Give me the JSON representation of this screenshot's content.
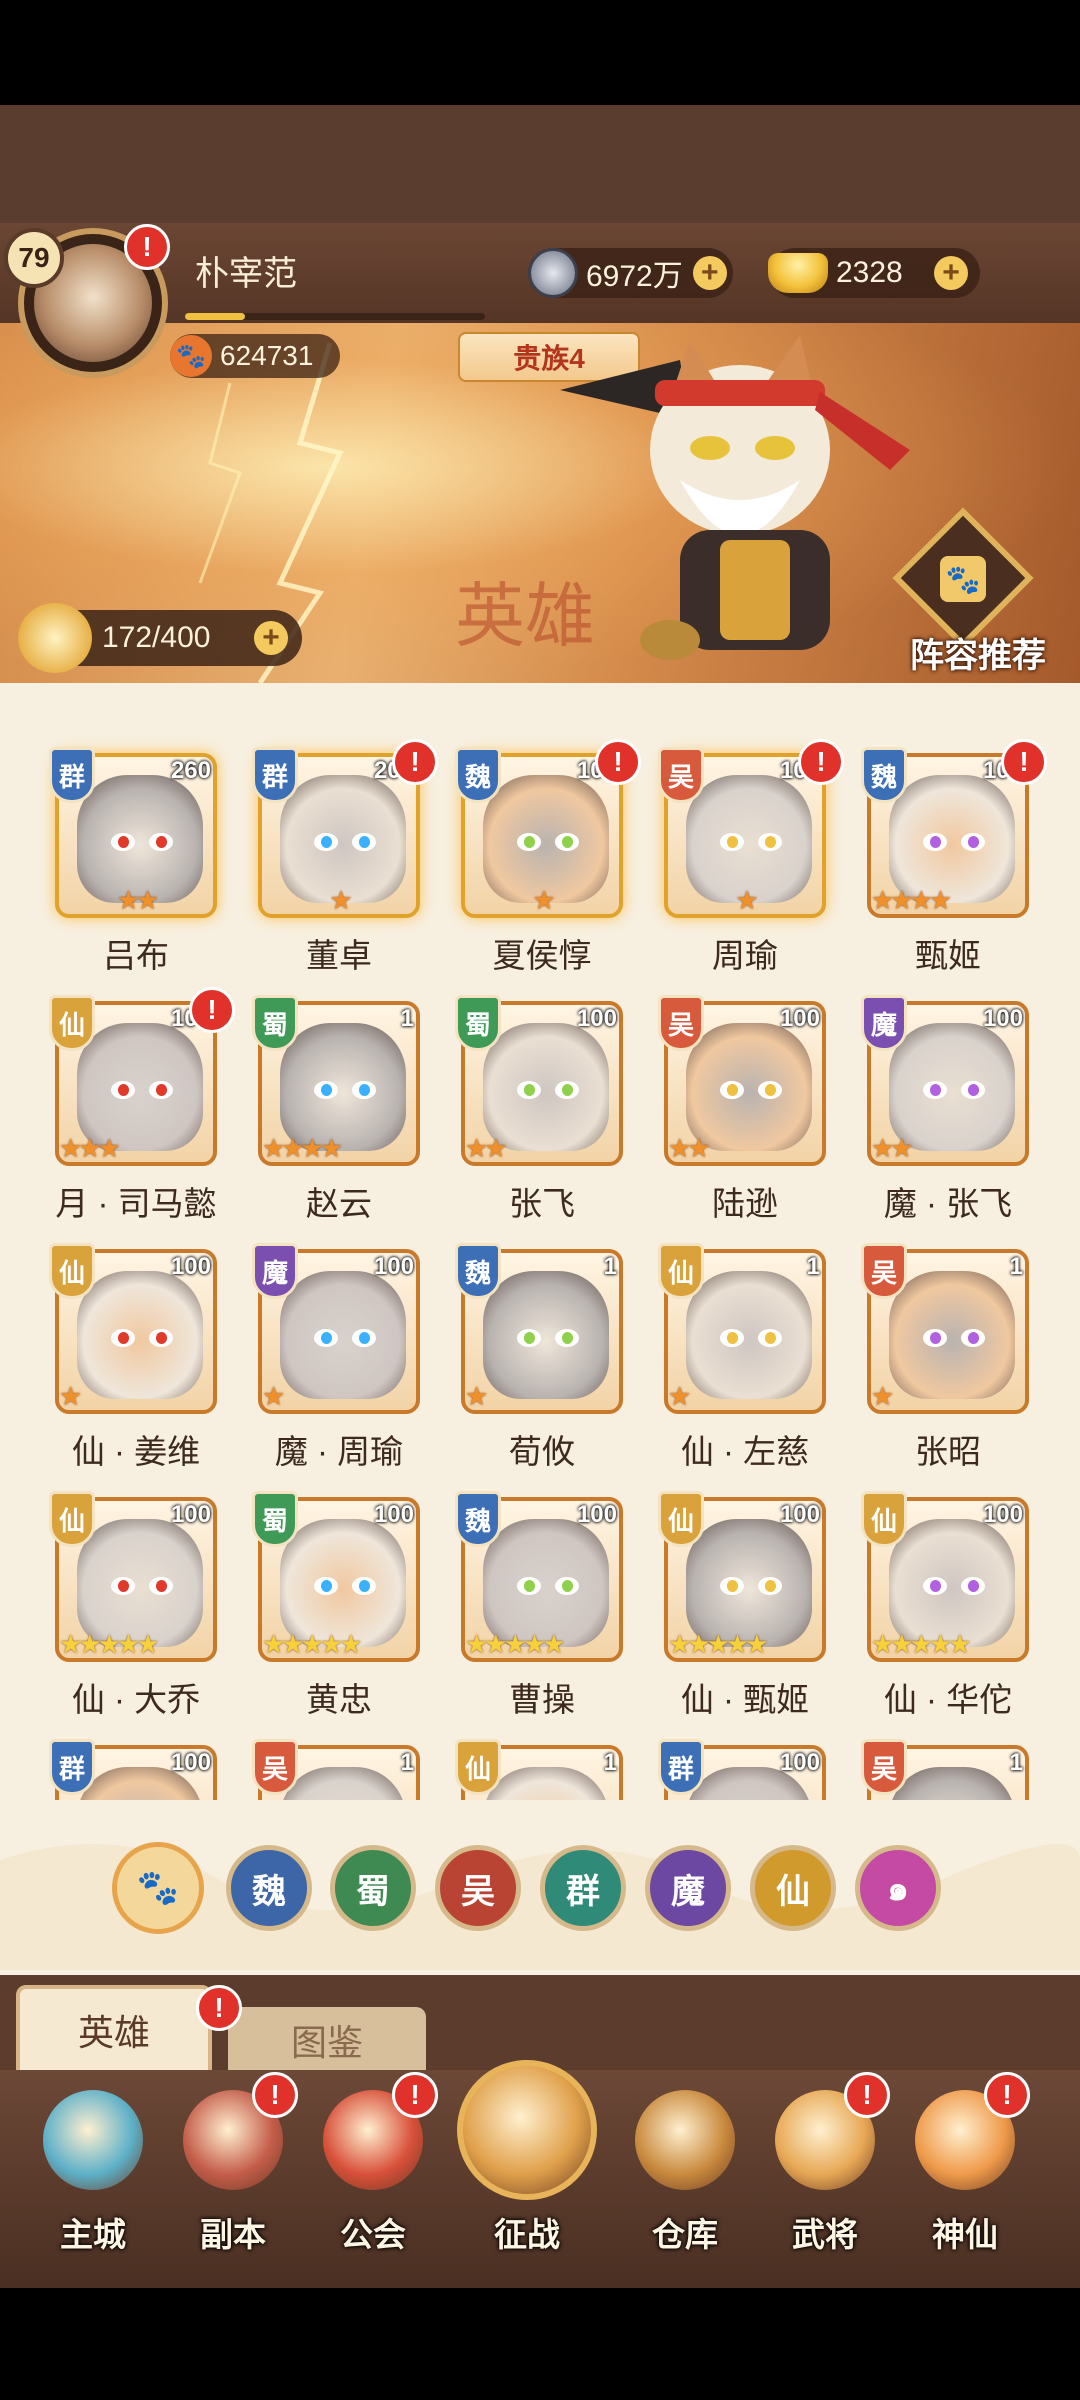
{
  "player": {
    "level": "79",
    "name": "朴宰范",
    "xp_fraction": 0.2,
    "power": "624731",
    "noble": "贵族4"
  },
  "currencies": {
    "coins": "6972万",
    "ingots": "2328"
  },
  "stamina": "172/400",
  "banner": {
    "watermark": "英雄",
    "lineup_label": "阵容推荐"
  },
  "heroes": [
    {
      "name": "吕布",
      "faction": "群",
      "count": "260",
      "stars": 2,
      "alert": false,
      "gold": true
    },
    {
      "name": "董卓",
      "faction": "群",
      "count": "201",
      "stars": 1,
      "alert": true,
      "gold": true
    },
    {
      "name": "夏侯惇",
      "faction": "魏",
      "count": "101",
      "stars": 1,
      "alert": true,
      "gold": true
    },
    {
      "name": "周瑜",
      "faction": "吴",
      "count": "100",
      "stars": 1,
      "alert": true,
      "gold": true
    },
    {
      "name": "甄姬",
      "faction": "魏",
      "count": "100",
      "stars": 4,
      "alert": true,
      "gold": false
    },
    {
      "name": "月 · 司马懿",
      "faction": "仙",
      "count": "100",
      "stars": 3,
      "alert": true,
      "gold": false
    },
    {
      "name": "赵云",
      "faction": "蜀",
      "count": "1",
      "stars": 4,
      "alert": false,
      "gold": false
    },
    {
      "name": "张飞",
      "faction": "蜀",
      "count": "100",
      "stars": 2,
      "alert": false,
      "gold": false
    },
    {
      "name": "陆逊",
      "faction": "吴",
      "count": "100",
      "stars": 2,
      "alert": false,
      "gold": false
    },
    {
      "name": "魔 · 张飞",
      "faction": "魔",
      "count": "100",
      "stars": 2,
      "alert": false,
      "gold": false
    },
    {
      "name": "仙 · 姜维",
      "faction": "仙",
      "count": "100",
      "stars": 1,
      "alert": false,
      "gold": false
    },
    {
      "name": "魔 · 周瑜",
      "faction": "魔",
      "count": "100",
      "stars": 1,
      "alert": false,
      "gold": false
    },
    {
      "name": "荀攸",
      "faction": "魏",
      "count": "1",
      "stars": 1,
      "alert": false,
      "gold": false
    },
    {
      "name": "仙 · 左慈",
      "faction": "仙",
      "count": "1",
      "stars": 1,
      "alert": false,
      "gold": false
    },
    {
      "name": "张昭",
      "faction": "吴",
      "count": "1",
      "stars": 1,
      "alert": false,
      "gold": false
    },
    {
      "name": "仙 · 大乔",
      "faction": "仙",
      "count": "100",
      "stars": 5,
      "alert": false,
      "gold": false
    },
    {
      "name": "黄忠",
      "faction": "蜀",
      "count": "100",
      "stars": 5,
      "alert": false,
      "gold": false
    },
    {
      "name": "曹操",
      "faction": "魏",
      "count": "100",
      "stars": 5,
      "alert": false,
      "gold": false
    },
    {
      "name": "仙 · 甄姬",
      "faction": "仙",
      "count": "100",
      "stars": 5,
      "alert": false,
      "gold": false
    },
    {
      "name": "仙 · 华佗",
      "faction": "仙",
      "count": "100",
      "stars": 5,
      "alert": false,
      "gold": false
    },
    {
      "name": "",
      "faction": "群",
      "count": "100",
      "stars": 0,
      "alert": false,
      "gold": false
    },
    {
      "name": "",
      "faction": "吴",
      "count": "1",
      "stars": 0,
      "alert": false,
      "gold": false
    },
    {
      "name": "",
      "faction": "仙",
      "count": "1",
      "stars": 0,
      "alert": false,
      "gold": false
    },
    {
      "name": "",
      "faction": "群",
      "count": "100",
      "stars": 0,
      "alert": false,
      "gold": false
    },
    {
      "name": "",
      "faction": "吴",
      "count": "1",
      "stars": 0,
      "alert": false,
      "gold": false
    }
  ],
  "faction_colors": {
    "群": "#3d6fb6",
    "魏": "#3d6fb6",
    "蜀": "#3f9a58",
    "吴": "#d85a3c",
    "仙": "#d9a23a",
    "魔": "#7a4fb0"
  },
  "filters": [
    {
      "label": "all-paw",
      "icon": "paw-icon",
      "bg": "#f4d79a",
      "fg": "#c0661c"
    },
    {
      "label": "魏",
      "bg": "#3c66a8",
      "fg": "#fff"
    },
    {
      "label": "蜀",
      "bg": "#3e8a52",
      "fg": "#fff"
    },
    {
      "label": "吴",
      "bg": "#b94434",
      "fg": "#fff"
    },
    {
      "label": "群",
      "bg": "#2f8a78",
      "fg": "#fff"
    },
    {
      "label": "魔",
      "bg": "#6c48a2",
      "fg": "#fff"
    },
    {
      "label": "仙",
      "bg": "#d19a2c",
      "fg": "#fff"
    },
    {
      "label": "swirl",
      "icon": "spiral-icon",
      "bg": "#c44aa4",
      "fg": "#fff"
    }
  ],
  "tabs": {
    "heroes": "英雄",
    "codex": "图鉴"
  },
  "nav": [
    {
      "label": "主城",
      "icon": "castle-icon",
      "alert": false,
      "color": "#5db0c8"
    },
    {
      "label": "副本",
      "icon": "sword-icon",
      "alert": true,
      "color": "#c45d4a"
    },
    {
      "label": "公会",
      "icon": "flag-icon",
      "alert": true,
      "color": "#d8503a"
    },
    {
      "label": "征战",
      "icon": "battle-emblem-icon",
      "alert": false,
      "color": "#e0a04a"
    },
    {
      "label": "仓库",
      "icon": "bag-icon",
      "alert": false,
      "color": "#c98a3e"
    },
    {
      "label": "武将",
      "icon": "cat-general-icon",
      "alert": true,
      "color": "#e7a855"
    },
    {
      "label": "神仙",
      "icon": "cat-deity-icon",
      "alert": true,
      "color": "#ef9a4a"
    }
  ]
}
